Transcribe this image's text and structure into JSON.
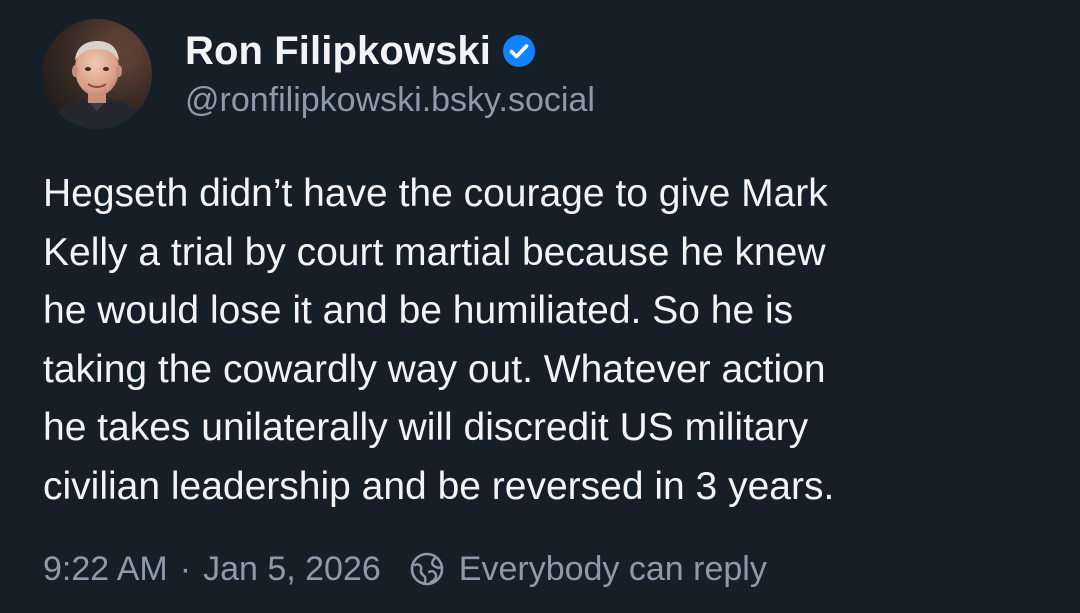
{
  "author": {
    "display_name": "Ron Filipkowski",
    "handle": "@ronfilipkowski.bsky.social",
    "verified_icon": "verified-check-badge-icon",
    "avatar": "user-avatar"
  },
  "post": {
    "lines": [
      "Hegseth didn’t have the courage to give Mark",
      "Kelly a trial by court martial because he knew",
      "he would lose it and be humiliated. So he is",
      "taking the cowardly way out. Whatever action",
      "he takes unilaterally will discredit US military",
      "civilian leadership and be reversed in 3 years."
    ]
  },
  "meta": {
    "time": "9:22 AM",
    "separator": "·",
    "date": "Jan 5, 2026",
    "reply_icon": "globe-icon",
    "reply_setting": "Everybody can reply"
  },
  "colors": {
    "background": "#161e27",
    "text": "#f1f3f5",
    "muted": "#8d9aab",
    "verified_blue": "#1083fe"
  }
}
